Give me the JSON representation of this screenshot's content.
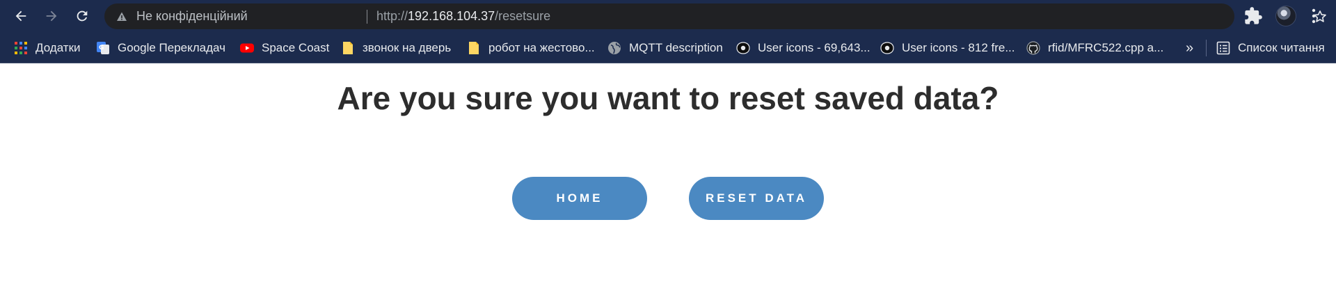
{
  "browser": {
    "security_label": "Не конфіденційний",
    "url_scheme": "http://",
    "url_host": "192.168.104.37",
    "url_path": "/resetsure"
  },
  "bookmarks": {
    "items": [
      {
        "label": "Додатки",
        "icon": "apps-grid-icon"
      },
      {
        "label": "Google Перекладач",
        "icon": "google-translate-icon"
      },
      {
        "label": "Space Coast",
        "icon": "youtube-icon"
      },
      {
        "label": "звонок на дверь",
        "icon": "file-icon"
      },
      {
        "label": "робот на жестово...",
        "icon": "file-icon"
      },
      {
        "label": "MQTT description",
        "icon": "globe-icon"
      },
      {
        "label": "User icons - 69,643...",
        "icon": "user-icons-site-icon"
      },
      {
        "label": "User icons - 812 fre...",
        "icon": "user-icons-site-icon"
      },
      {
        "label": "rfid/MFRC522.cpp a...",
        "icon": "github-icon"
      }
    ],
    "overflow": "»",
    "reading_list": "Список читання"
  },
  "page": {
    "title": "Are you sure you want to reset saved data?",
    "home_button": "HOME",
    "reset_button": "RESET DATA"
  },
  "colors": {
    "chrome_background": "#1c2b4d",
    "omnibox_background": "#202124",
    "button_background": "#4b89c2",
    "title_color": "#2d2d2d"
  }
}
